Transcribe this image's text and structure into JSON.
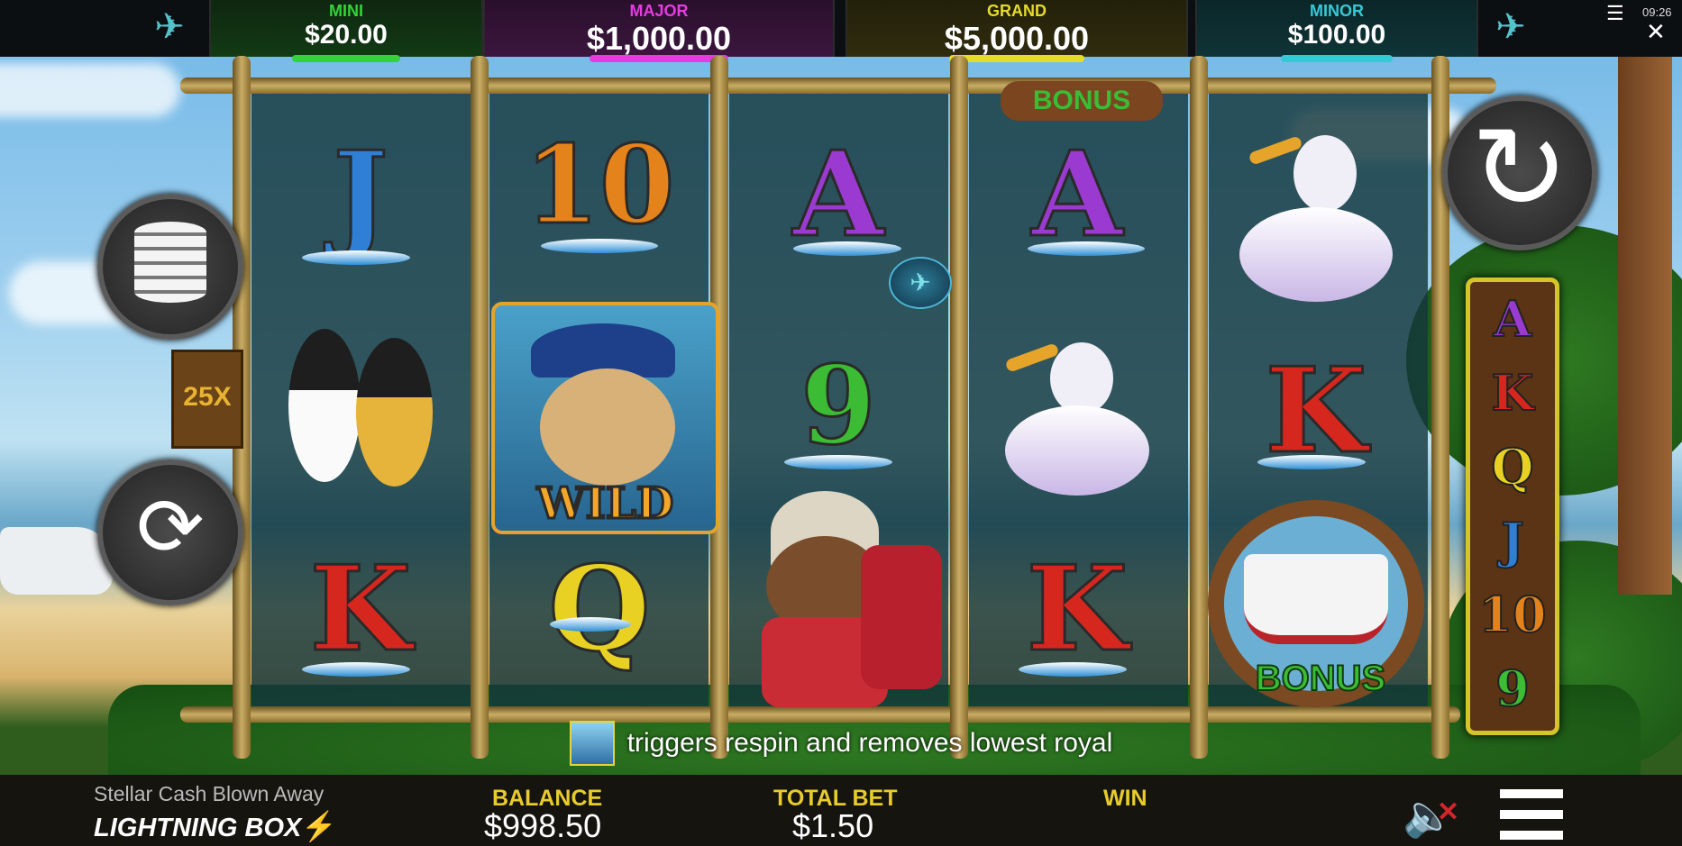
{
  "jackpots": [
    {
      "label": "MINI",
      "amount": "$20.00",
      "color": "#35d23a"
    },
    {
      "label": "MAJOR",
      "amount": "$1,000.00",
      "color": "#e43ce0"
    },
    {
      "label": "GRAND",
      "amount": "$5,000.00",
      "color": "#e6db2c"
    },
    {
      "label": "MINOR",
      "amount": "$100.00",
      "color": "#35c9d6"
    }
  ],
  "clock": "09:26",
  "multiplier": "25X",
  "reels": [
    [
      "J",
      "penguins",
      "K"
    ],
    [
      "10",
      "WILD",
      "Q"
    ],
    [
      "A",
      "9",
      "monkey"
    ],
    [
      "A",
      "pelican",
      "K"
    ],
    [
      "pelican",
      "K",
      "BONUS"
    ]
  ],
  "wild_label": "WILD",
  "bonus_label": "BONUS",
  "bonus_top_label": "BONUS",
  "royal_ladder": [
    "A",
    "K",
    "Q",
    "J",
    "10",
    "9"
  ],
  "info_text": "triggers respin and removes lowest royal",
  "game_name": "Stellar Cash Blown Away",
  "brand": "LIGHTNING BOX",
  "balance_label": "BALANCE",
  "balance_value": "$998.50",
  "total_bet_label": "TOTAL BET",
  "total_bet_value": "$1.50",
  "win_label": "WIN",
  "win_value": "",
  "icons": [
    "menu-icon",
    "close-icon",
    "coins-icon",
    "autoplay-icon",
    "spin-icon",
    "mute-icon",
    "hamburger-icon",
    "tornado-icon",
    "lightning-icon"
  ]
}
